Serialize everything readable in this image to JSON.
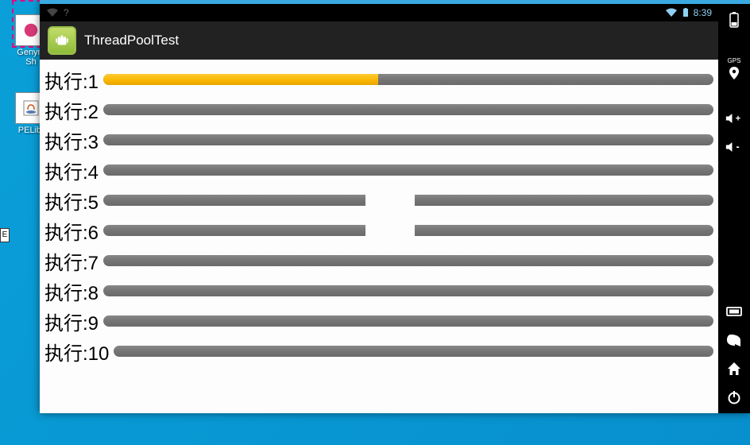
{
  "desktop": {
    "icons": [
      {
        "label": "Genym\nSh"
      },
      {
        "label": "PELib."
      }
    ],
    "side_stub": "E"
  },
  "status_bar": {
    "time": "8:39"
  },
  "app": {
    "title": "ThreadPoolTest"
  },
  "rows": [
    {
      "label": "执行:1",
      "progress": 45,
      "gap_start": null,
      "gap_width": null
    },
    {
      "label": "执行:2",
      "progress": 0,
      "gap_start": null,
      "gap_width": null
    },
    {
      "label": "执行:3",
      "progress": 0,
      "gap_start": null,
      "gap_width": null
    },
    {
      "label": "执行:4",
      "progress": 0,
      "gap_start": null,
      "gap_width": null
    },
    {
      "label": "执行:5",
      "progress": 0,
      "gap_start": 43,
      "gap_width": 8
    },
    {
      "label": "执行:6",
      "progress": 0,
      "gap_start": 43,
      "gap_width": 8
    },
    {
      "label": "执行:7",
      "progress": 0,
      "gap_start": null,
      "gap_width": null
    },
    {
      "label": "执行:8",
      "progress": 0,
      "gap_start": null,
      "gap_width": null
    },
    {
      "label": "执行:9",
      "progress": 0,
      "gap_start": null,
      "gap_width": null
    },
    {
      "label": "执行:10",
      "progress": 0,
      "gap_start": null,
      "gap_width": null
    }
  ],
  "toolbar": {
    "gps_label": "GPS"
  }
}
